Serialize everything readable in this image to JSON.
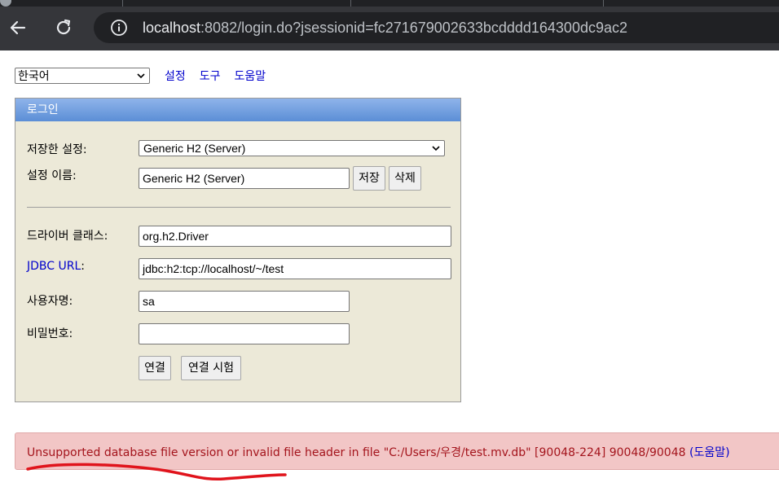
{
  "browser": {
    "url_host": "localhost",
    "url_rest": ":8082/login.do?jsessionid=fc271679002633bcdddd164300dc9ac2",
    "icons": [
      "back-arrow-icon",
      "reload-icon",
      "info-icon"
    ]
  },
  "topbar": {
    "language_selected": "한국어",
    "links": [
      "설정",
      "도구",
      "도움말"
    ]
  },
  "login": {
    "title": "로그인",
    "saved_settings_label": "저장한 설정:",
    "saved_settings_value": "Generic H2 (Server)",
    "setting_name_label": "설정 이름:",
    "setting_name_value": "Generic H2 (Server)",
    "save_button": "저장",
    "delete_button": "삭제",
    "driver_class_label": "드라이버 클래스:",
    "driver_class_value": "org.h2.Driver",
    "jdbc_url_label": "JDBC URL",
    "jdbc_url_colon": ":",
    "jdbc_url_value": "jdbc:h2:tcp://localhost/~/test",
    "username_label": "사용자명:",
    "username_value": "sa",
    "password_label": "비밀번호:",
    "password_value": "",
    "connect_button": "연결",
    "test_connection_button": "연결 시험"
  },
  "error": {
    "message": "Unsupported database file version or invalid file header in file \"C:/Users/우경/test.mv.db\" [90048-224] 90048/90048",
    "help_link": "(도움말)"
  },
  "colors": {
    "login_header": "#5b8ed6",
    "panel_bg": "#ece9d8",
    "error_bg": "#f2c6c6",
    "error_text": "#a4141c",
    "link": "#0000cc",
    "annotation": "#e0141c"
  }
}
